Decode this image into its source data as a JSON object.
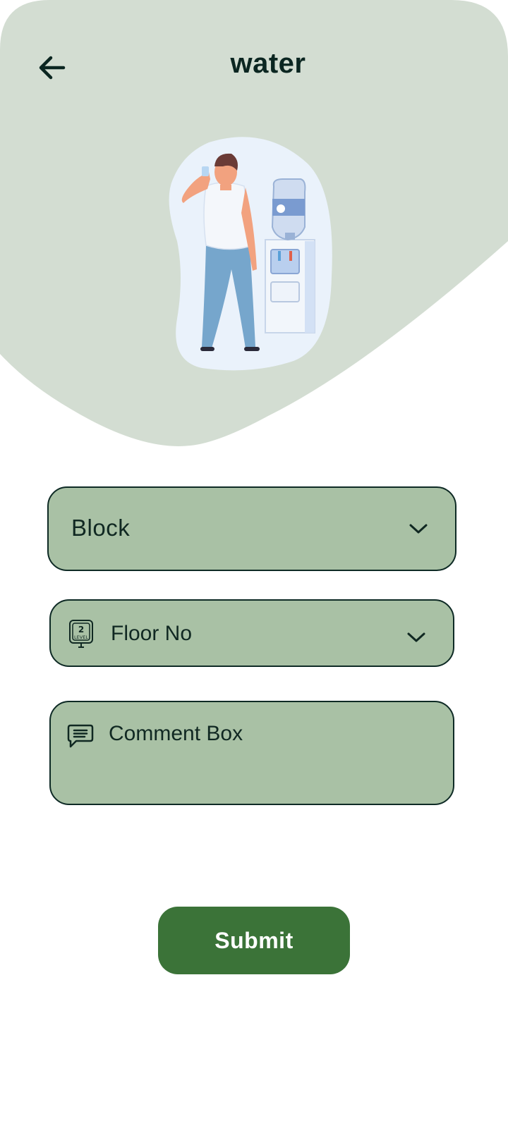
{
  "header": {
    "title": "water",
    "back_icon": "arrow-left-icon"
  },
  "colors": {
    "hero_bg": "#d3ddd2",
    "field_bg": "#a9c1a5",
    "field_border": "#0e2a25",
    "submit_bg": "#3b7338",
    "text_dark": "#0b2621"
  },
  "form": {
    "block": {
      "label": "Block",
      "icon": "chevron-down-icon"
    },
    "floor": {
      "label": "Floor No",
      "icon": "floor-level-icon",
      "icon_text_top": "2",
      "icon_text_bottom": "LEVEL"
    },
    "comment": {
      "label": "Comment Box",
      "icon": "chat-message-icon"
    },
    "submit_label": "Submit"
  }
}
